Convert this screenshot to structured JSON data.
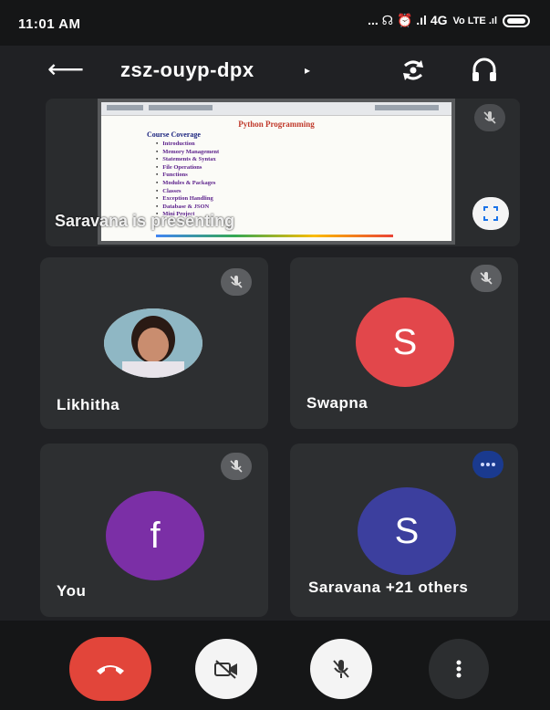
{
  "status_bar": {
    "time": "11:01 AM",
    "indicators": "... ☊ ⏰ .ıl 4G",
    "network": "Vo LTE .ıl"
  },
  "header": {
    "meeting_code": "zsz-ouyp-dpx",
    "caret": "▸",
    "icons": [
      "back-arrow-icon",
      "switch-camera-icon",
      "headphones-icon"
    ]
  },
  "presentation": {
    "label": "Saravana is presenting",
    "slide": {
      "title": "Python Programming",
      "heading": "Course Coverage",
      "items": [
        "Introduction",
        "Memory Management",
        "Statements & Syntax",
        "File Operations",
        "Functions",
        "Modules & Packages",
        "Classes",
        "Exception Handling",
        "Database & JSON",
        "Mini Project"
      ]
    }
  },
  "participants": [
    {
      "name": "Likhitha",
      "initial": "",
      "avatar_color": "#d7c6c0",
      "mic": "muted"
    },
    {
      "name": "Swapna",
      "initial": "S",
      "avatar_color": "#e2474b",
      "mic": "muted"
    },
    {
      "name": "You",
      "initial": "f",
      "avatar_color": "#7b2fa6",
      "mic": "muted"
    },
    {
      "name": "Saravana +21 others",
      "initial": "S",
      "avatar_color": "#3c3f9e",
      "mic": "speaking"
    }
  ],
  "controls": {
    "end_call": "end-call-icon",
    "camera": "camera-off-icon",
    "mic": "mic-off-icon",
    "more": "more-options-icon"
  },
  "colors": {
    "background": "#202124",
    "tile": "#2d2f31",
    "end_call": "#e2453a",
    "speaking_badge": "#1a3a8f"
  }
}
